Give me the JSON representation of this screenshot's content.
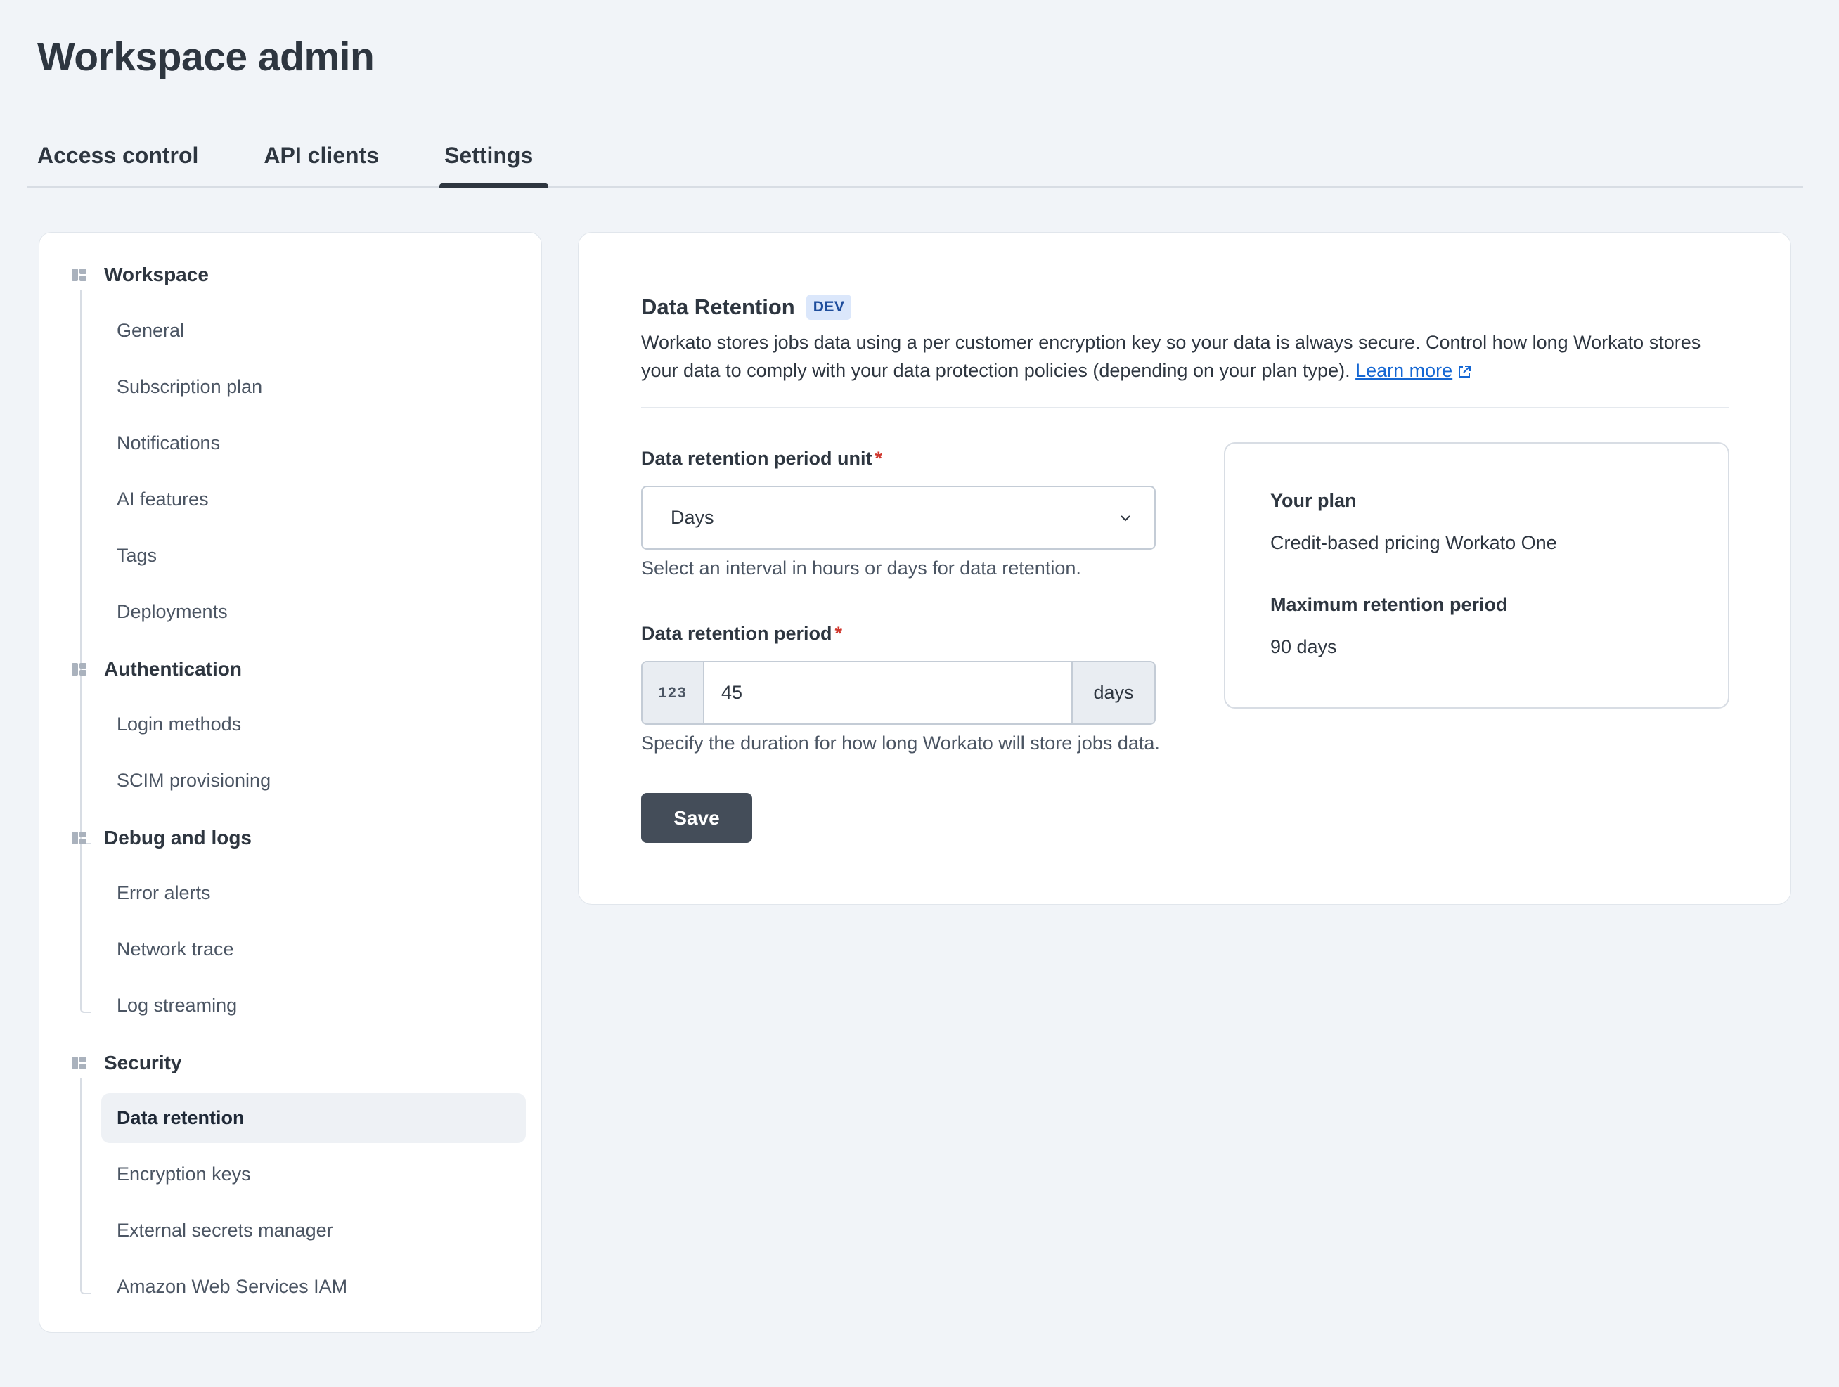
{
  "page": {
    "title": "Workspace admin"
  },
  "tabs": [
    {
      "label": "Access control"
    },
    {
      "label": "API clients"
    },
    {
      "label": "Settings",
      "active": true
    }
  ],
  "sidebar": {
    "groups": [
      {
        "label": "Workspace",
        "items": [
          "General",
          "Subscription plan",
          "Notifications",
          "AI features",
          "Tags",
          "Deployments"
        ]
      },
      {
        "label": "Authentication",
        "items": [
          "Login methods",
          "SCIM provisioning"
        ]
      },
      {
        "label": "Debug and logs",
        "items": [
          "Error alerts",
          "Network trace",
          "Log streaming"
        ]
      },
      {
        "label": "Security",
        "items": [
          "Data retention",
          "Encryption keys",
          "External secrets manager",
          "Amazon Web Services IAM"
        ]
      }
    ],
    "active_item": "Data retention"
  },
  "main": {
    "title": "Data Retention",
    "badge": "DEV",
    "description": "Workato stores jobs data using a per customer encryption key so your data is always secure. Control how long Workato stores your data to comply with your data protection policies (depending on your plan type).",
    "learn_more": "Learn more",
    "unit_field": {
      "label": "Data retention period unit",
      "required_mark": "*",
      "value": "Days",
      "hint": "Select an interval in hours or days for data retention."
    },
    "period_field": {
      "label": "Data retention period",
      "required_mark": "*",
      "prefix": "123",
      "value": "45",
      "suffix": "days",
      "hint": "Specify the duration for how long Workato will store jobs data."
    },
    "save_label": "Save",
    "plan": {
      "plan_label": "Your plan",
      "plan_value": "Credit-based pricing Workato One",
      "max_label": "Maximum retention period",
      "max_value": "90 days"
    }
  },
  "colors": {
    "background": "#f1f4f8",
    "primary_button": "#444d59",
    "link": "#1567d3",
    "badge_bg": "#dbe7fb",
    "required": "#d0362c"
  }
}
